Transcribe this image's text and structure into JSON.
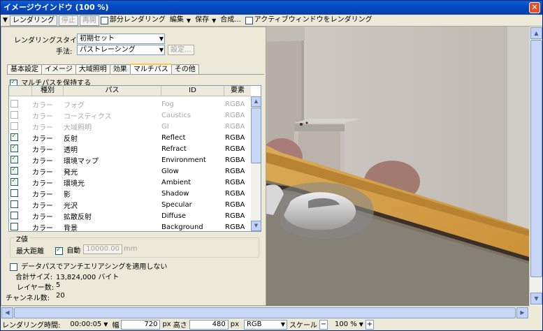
{
  "window": {
    "title": "イメージウインドウ (100 %)",
    "close_glyph": "✕"
  },
  "toolbar": {
    "menu_glyph": "▼",
    "render_label": "レンダリング",
    "stop_label": "停止",
    "resume_label": "再開",
    "partial_render_label": "部分レンダリング",
    "edit_label": "編集",
    "save_label": "保存",
    "compose_label": "合成...",
    "active_window_render_label": "アクティブウィンドウをレンダリング",
    "dropdown_glyph": "▼"
  },
  "panel": {
    "style_label": "レンダリングスタイル:",
    "style_value": "初期セット",
    "method_label": "手法:",
    "method_value": "パストレーシング",
    "settings_label": "設定...",
    "tabs": [
      "基本設定",
      "イメージ",
      "大域照明",
      "効果",
      "マルチパス",
      "その他"
    ],
    "keep_multipass_label": "マルチパスを保持する",
    "columns": [
      "種別",
      "パス",
      "ID",
      "要素"
    ],
    "rows": [
      {
        "type": "カラー",
        "pass": "フォグ",
        "id": "Fog",
        "element": "RGBA"
      },
      {
        "type": "カラー",
        "pass": "コースティクス",
        "id": "Caustics",
        "element": "RGBA"
      },
      {
        "type": "カラー",
        "pass": "大域照明",
        "id": "GI",
        "element": "RGBA"
      },
      {
        "type": "カラー",
        "pass": "反射",
        "id": "Reflect",
        "element": "RGBA"
      },
      {
        "type": "カラー",
        "pass": "透明",
        "id": "Refract",
        "element": "RGBA"
      },
      {
        "type": "カラー",
        "pass": "環境マップ",
        "id": "Environment",
        "element": "RGBA"
      },
      {
        "type": "カラー",
        "pass": "発光",
        "id": "Glow",
        "element": "RGBA"
      },
      {
        "type": "カラー",
        "pass": "環境光",
        "id": "Ambient",
        "element": "RGBA"
      },
      {
        "type": "カラー",
        "pass": "影",
        "id": "Shadow",
        "element": "RGBA"
      },
      {
        "type": "カラー",
        "pass": "光沢",
        "id": "Specular",
        "element": "RGBA"
      },
      {
        "type": "カラー",
        "pass": "拡散反射",
        "id": "Diffuse",
        "element": "RGBA"
      },
      {
        "type": "カラー",
        "pass": "背景",
        "id": "Background",
        "element": "RGBA"
      }
    ],
    "z_group_label": "Z値",
    "max_distance_label": "最大距離",
    "auto_label": "自動",
    "distance_value": "10000.00",
    "distance_unit": "mm",
    "antialias_label": "データパスでアンチエリアシングを適用しない",
    "total_size_label": "合計サイズ:",
    "total_size_value": "13,824,000 バイト",
    "layers_label": "レイヤー数:",
    "layers_value": "5",
    "channels_label": "チャンネル数:",
    "channels_value": "20"
  },
  "statusbar": {
    "render_time_label": "レンダリング時間:",
    "render_time_value": "00:00:05",
    "width_label": "幅",
    "width_value": "720",
    "width_unit": "px",
    "height_label": "高さ",
    "height_value": "480",
    "height_unit": "px",
    "color_mode": "RGB",
    "scale_label": "スケール",
    "scale_minus": "−",
    "zoom_value": "100 %",
    "scale_plus": "+"
  },
  "scroll": {
    "up": "▲",
    "down": "▼",
    "left": "◀",
    "right": "▶"
  }
}
